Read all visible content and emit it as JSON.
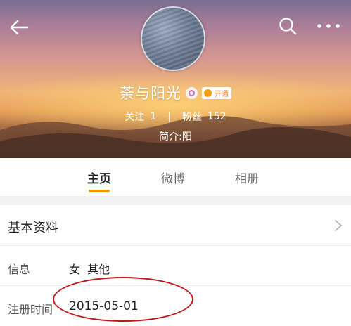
{
  "profile": {
    "username": "荼与阳光",
    "vip_label": "开通",
    "stats": {
      "following_label": "关注",
      "following_count": "1",
      "followers_label": "粉丝",
      "followers_count": "152"
    },
    "bio": "简介:阳"
  },
  "tabs": [
    {
      "label": "主页",
      "active": true
    },
    {
      "label": "微博",
      "active": false
    },
    {
      "label": "相册",
      "active": false
    }
  ],
  "basic_info": {
    "title": "基本资料",
    "rows": [
      {
        "label": "信息",
        "value": "女  其他"
      },
      {
        "label": "注册时间",
        "value": "2015-05-01"
      }
    ]
  },
  "icons": {
    "back": "arrow-left-icon",
    "search": "search-icon",
    "more": "more-icon",
    "chevron": "chevron-right-icon"
  },
  "colors": {
    "tab_underline": "#f29400",
    "highlight_circle": "#c0171b"
  }
}
